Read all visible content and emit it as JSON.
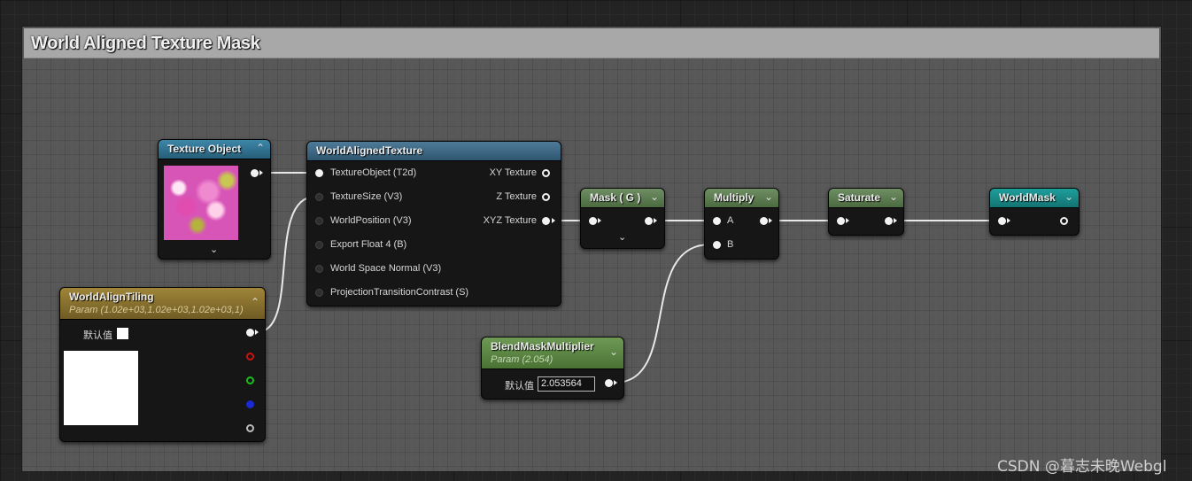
{
  "comment": {
    "title": "World Aligned Texture Mask"
  },
  "nodes": {
    "texture_object": {
      "title": "Texture Object",
      "colors": {
        "header": "#2f6d8a"
      }
    },
    "world_aligned_texture": {
      "title": "WorldAlignedTexture",
      "inputs": [
        "TextureObject (T2d)",
        "TextureSize (V3)",
        "WorldPosition (V3)",
        "Export Float 4 (B)",
        "World Space Normal (V3)",
        "ProjectionTransitionContrast (S)"
      ],
      "outputs": [
        "XY Texture",
        "Z Texture",
        "XYZ Texture"
      ]
    },
    "mask": {
      "title": "Mask ( G )"
    },
    "multiply": {
      "title": "Multiply",
      "inputs": [
        "A",
        "B"
      ]
    },
    "saturate": {
      "title": "Saturate"
    },
    "world_mask": {
      "title": "WorldMask"
    },
    "world_align_tiling": {
      "title": "WorldAlignTiling",
      "subtitle": "Param (1.02e+03,1.02e+03,1.02e+03,1)",
      "default_label": "默认值"
    },
    "blend_mask_multiplier": {
      "title": "BlendMaskMultiplier",
      "subtitle": "Param (2.054)",
      "default_label": "默认值",
      "default_value": "2.053564"
    }
  },
  "icons": {
    "collapse": "chevron-up-icon",
    "expand": "chevron-down-icon"
  },
  "colors": {
    "vector_param": "#8a7030",
    "scalar_param": "#5a8a3a",
    "math": "#5f7f50",
    "result": "#1b8a8a"
  },
  "watermark": "CSDN @暮志未晚Webgl"
}
